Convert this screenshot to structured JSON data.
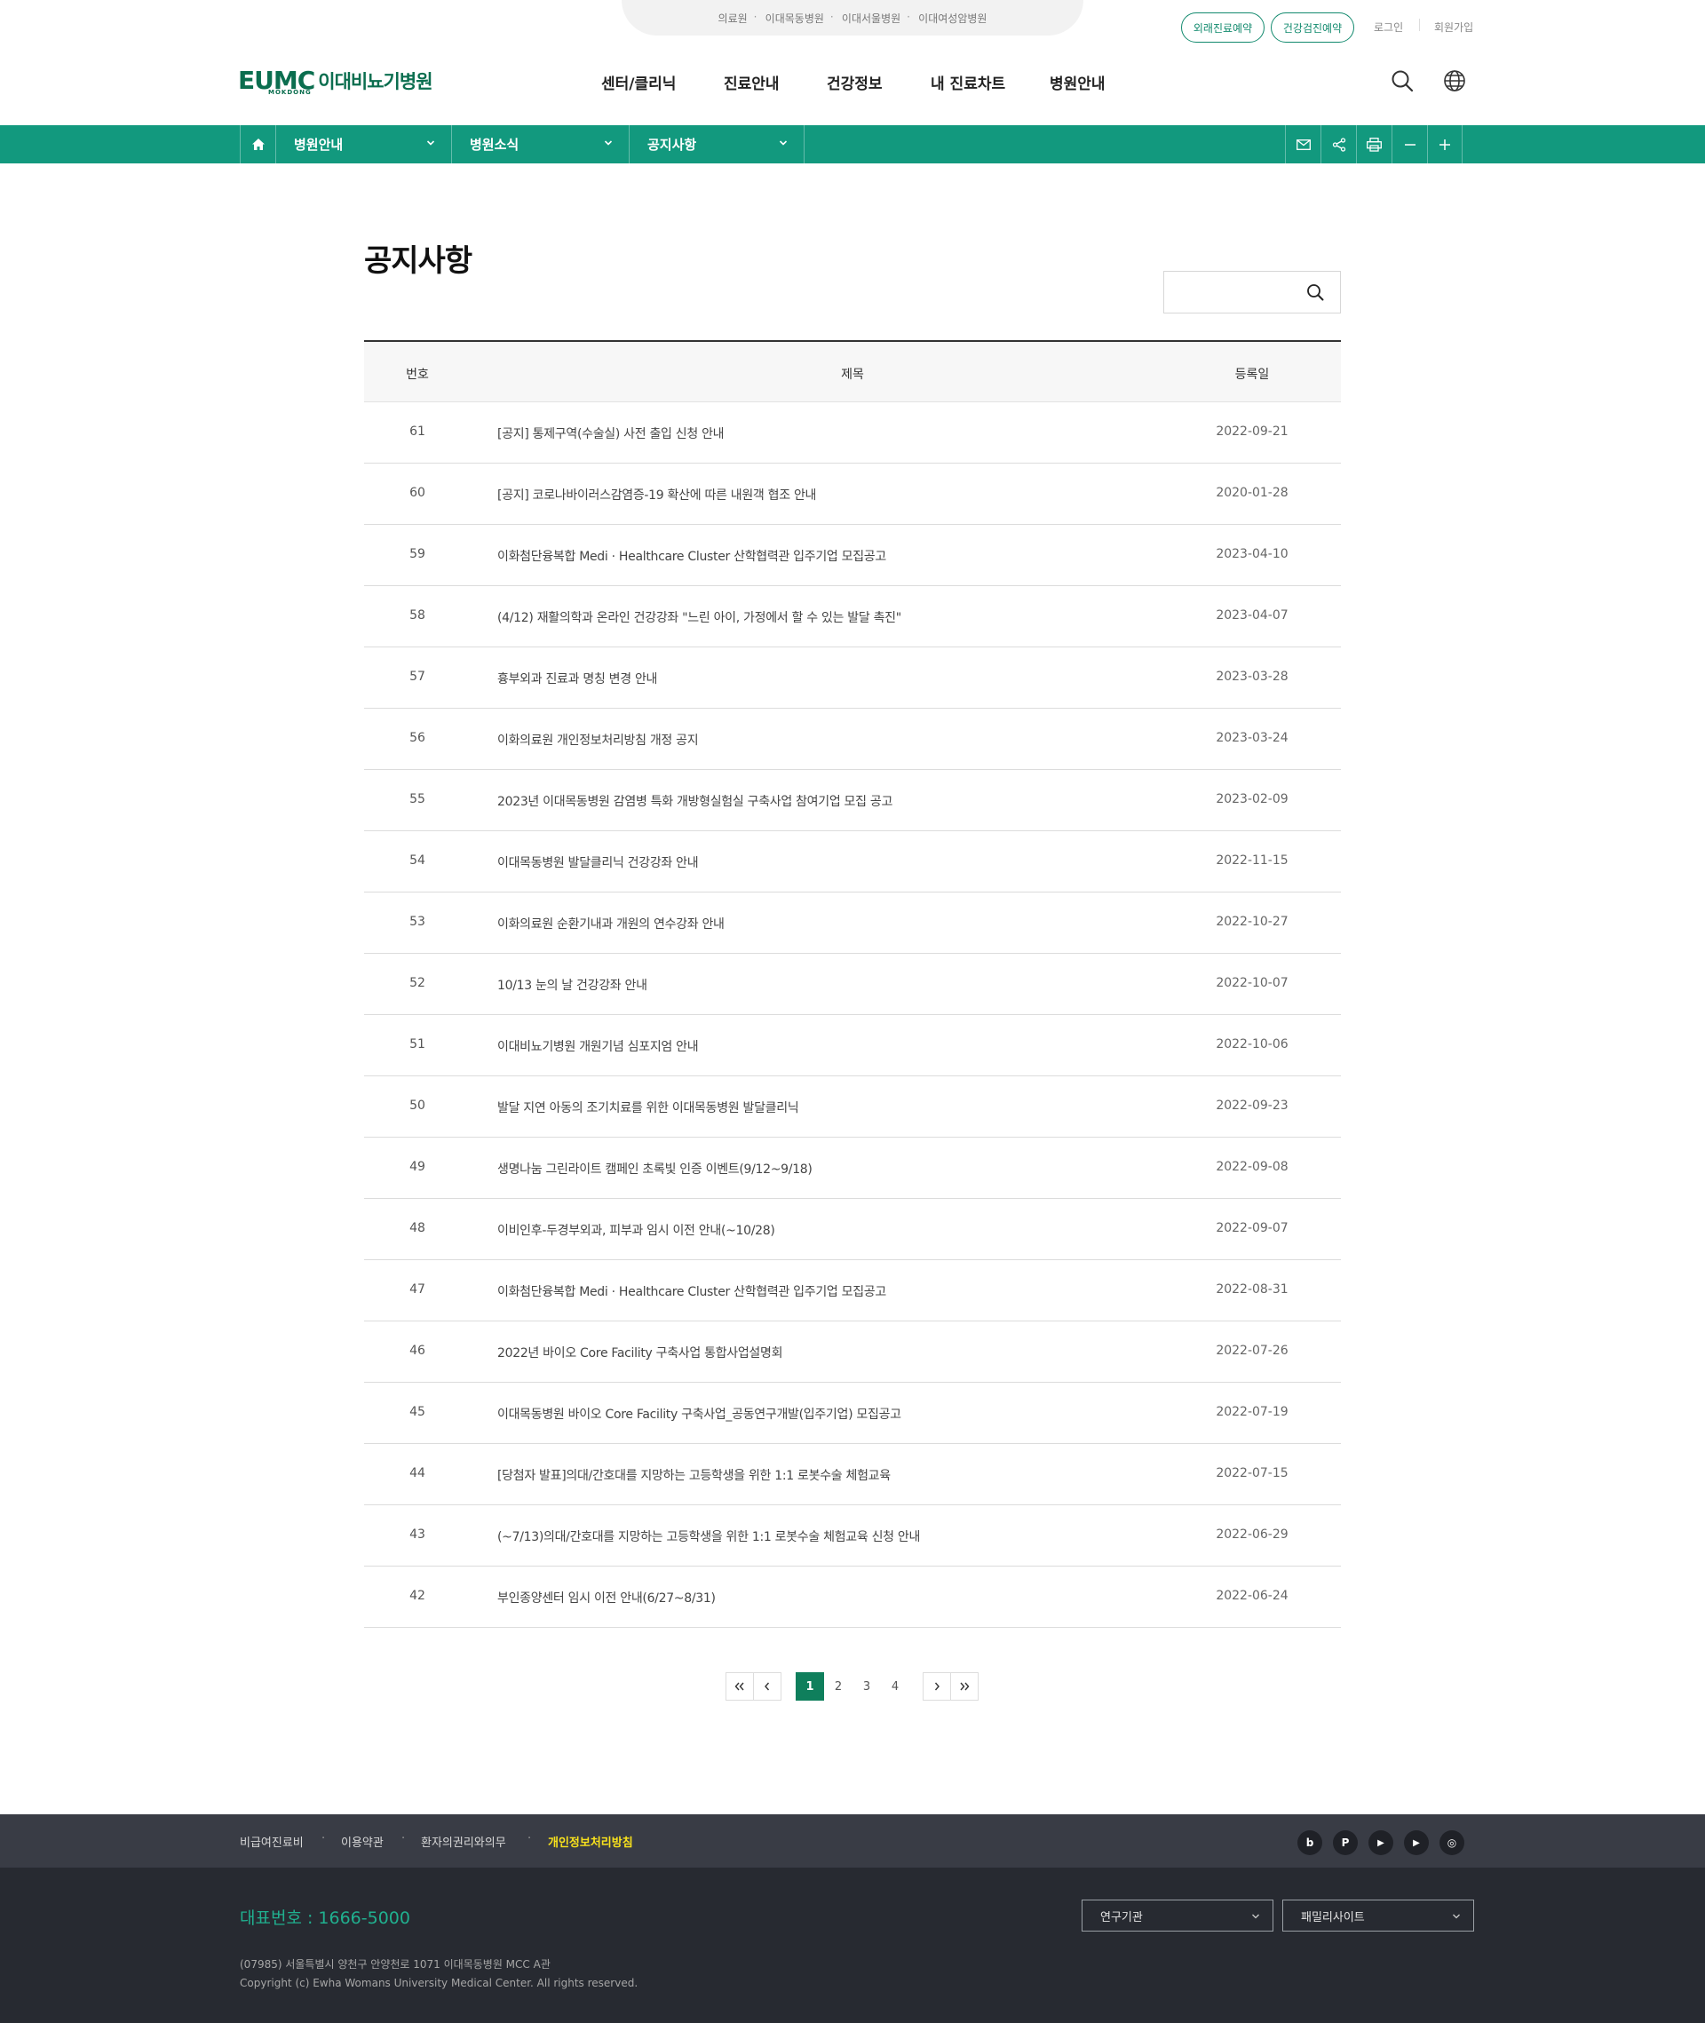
{
  "family_sites": [
    "의료원",
    "이대목동병원",
    "이대서울병원",
    "이대여성암병원"
  ],
  "top_buttons": {
    "outpatient": "외래진료예약",
    "checkup": "건강검진예약"
  },
  "top_links": {
    "login": "로그인",
    "join": "회원가입"
  },
  "logo": {
    "mark": "EUMC",
    "sub": "MOKDONG",
    "name": "이대비뇨기병원"
  },
  "gnb": [
    "센터/클리닉",
    "진료안내",
    "건강정보",
    "내 진료차트",
    "병원안내"
  ],
  "icons": {
    "search": "search-icon",
    "globe": "globe-icon",
    "home": "home-icon",
    "mail": "mail-icon",
    "share": "share-icon",
    "print": "print-icon",
    "zoom_out": "minus-icon",
    "zoom_in": "plus-icon"
  },
  "location": [
    "병원안내",
    "병원소식",
    "공지사항"
  ],
  "page_title": "공지사항",
  "search": {
    "placeholder": ""
  },
  "table": {
    "headers": [
      "번호",
      "제목",
      "등록일"
    ],
    "rows": [
      {
        "num": "61",
        "title": "[공지] 통제구역(수술실) 사전 출입 신청 안내",
        "date": "2022-09-21"
      },
      {
        "num": "60",
        "title": "[공지] 코로나바이러스감염증-19 확산에 따른 내원객 협조 안내",
        "date": "2020-01-28"
      },
      {
        "num": "59",
        "title": "이화첨단융복합 Medi · Healthcare Cluster 산학협력관 입주기업 모집공고",
        "date": "2023-04-10"
      },
      {
        "num": "58",
        "title": "(4/12) 재활의학과 온라인 건강강좌 \"느린 아이, 가정에서 할 수 있는 발달 촉진\"",
        "date": "2023-04-07"
      },
      {
        "num": "57",
        "title": "흉부외과 진료과 명칭 변경 안내",
        "date": "2023-03-28"
      },
      {
        "num": "56",
        "title": "이화의료원 개인정보처리방침 개정 공지",
        "date": "2023-03-24"
      },
      {
        "num": "55",
        "title": "2023년 이대목동병원 감염병 특화 개방형실험실 구축사업 참여기업 모집 공고",
        "date": "2023-02-09"
      },
      {
        "num": "54",
        "title": "이대목동병원 발달클리닉 건강강좌 안내",
        "date": "2022-11-15"
      },
      {
        "num": "53",
        "title": "이화의료원 순환기내과 개원의 연수강좌 안내",
        "date": "2022-10-27"
      },
      {
        "num": "52",
        "title": "10/13 눈의 날 건강강좌 안내",
        "date": "2022-10-07"
      },
      {
        "num": "51",
        "title": "이대비뇨기병원 개원기념 심포지엄 안내",
        "date": "2022-10-06"
      },
      {
        "num": "50",
        "title": "발달 지연 아동의 조기치료를 위한 이대목동병원 발달클리닉",
        "date": "2022-09-23"
      },
      {
        "num": "49",
        "title": "생명나눔 그린라이트 캠페인 초록빛 인증 이벤트(9/12~9/18)",
        "date": "2022-09-08"
      },
      {
        "num": "48",
        "title": "이비인후-두경부외과, 피부과 임시 이전 안내(~10/28)",
        "date": "2022-09-07"
      },
      {
        "num": "47",
        "title": "이화첨단융복합 Medi · Healthcare Cluster 산학협력관 입주기업 모집공고",
        "date": "2022-08-31"
      },
      {
        "num": "46",
        "title": "2022년 바이오 Core Facility 구축사업 통합사업설명회",
        "date": "2022-07-26"
      },
      {
        "num": "45",
        "title": "이대목동병원 바이오 Core Facility 구축사업_공동연구개발(입주기업) 모집공고",
        "date": "2022-07-19"
      },
      {
        "num": "44",
        "title": "[당첨자 발표]의대/간호대를 지망하는 고등학생을 위한 1:1 로봇수술 체험교육",
        "date": "2022-07-15"
      },
      {
        "num": "43",
        "title": "(~7/13)의대/간호대를 지망하는 고등학생을 위한 1:1 로봇수술 체험교육 신청 안내",
        "date": "2022-06-29"
      },
      {
        "num": "42",
        "title": "부인종양센터 임시 이전 안내(6/27~8/31)",
        "date": "2022-06-24"
      }
    ]
  },
  "pagination": {
    "pages": [
      "1",
      "2",
      "3",
      "4"
    ],
    "current": "1"
  },
  "footer": {
    "links": [
      "비급여진료비",
      "이용약관",
      "환자의권리와의무",
      "개인정보처리방침"
    ],
    "sns": [
      "b",
      "P",
      "▶",
      "▶",
      "◎"
    ],
    "tel": "대표번호 : 1666-5000",
    "address": "(07985) 서울특별시 양천구 안양천로 1071 이대목동병원 MCC A관",
    "copyright": "Copyright (c) Ewha Womans University Medical Center. All rights reserved.",
    "selects": [
      "연구기관",
      "패밀리사이트"
    ]
  },
  "colors": {
    "brand": "#0b6e4f",
    "bar": "#12997e",
    "highlight": "#f9e21c"
  }
}
